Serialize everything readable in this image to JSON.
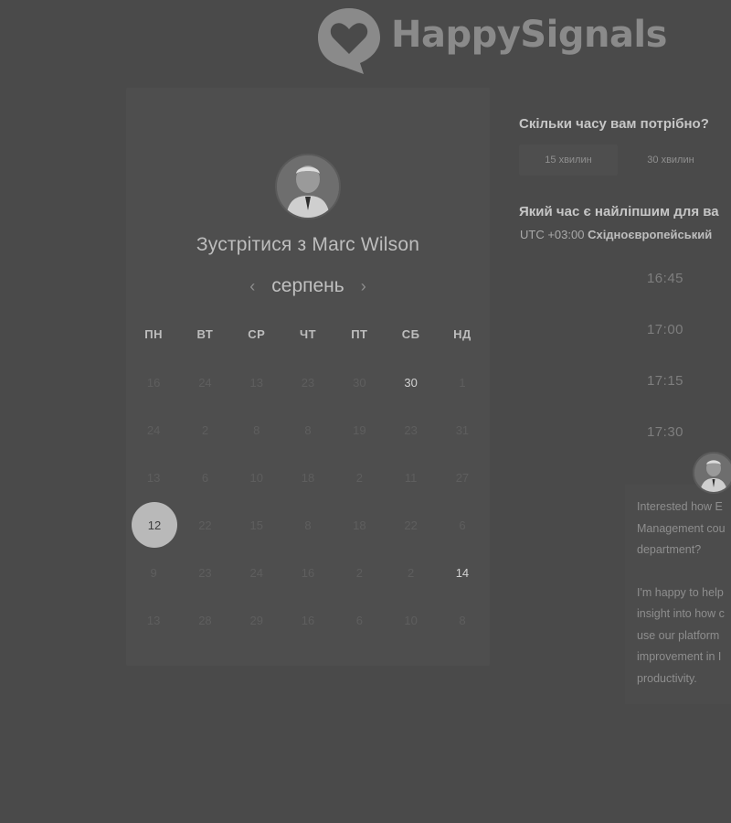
{
  "brand": {
    "name": "HappySignals",
    "logo_icon": "heart-speech-bubble-icon",
    "logo_color": "#8a8a8a"
  },
  "calendar": {
    "host_avatar": "person-avatar",
    "title": "Зустрітися з Marc Wilson",
    "month": "серпень",
    "prev_icon": "chevron-left-icon",
    "next_icon": "chevron-right-icon",
    "weekdays": [
      "ПН",
      "ВТ",
      "СР",
      "ЧТ",
      "ПТ",
      "СБ",
      "НД"
    ],
    "weeks": [
      [
        {
          "d": "16",
          "s": "off"
        },
        {
          "d": "24",
          "s": "off"
        },
        {
          "d": "13",
          "s": "off"
        },
        {
          "d": "23",
          "s": "off"
        },
        {
          "d": "30",
          "s": "off"
        },
        {
          "d": "30",
          "s": "available"
        },
        {
          "d": "1",
          "s": "off"
        }
      ],
      [
        {
          "d": "24",
          "s": "off"
        },
        {
          "d": "2",
          "s": "off"
        },
        {
          "d": "8",
          "s": "off"
        },
        {
          "d": "8",
          "s": "off"
        },
        {
          "d": "19",
          "s": "off"
        },
        {
          "d": "23",
          "s": "off"
        },
        {
          "d": "31",
          "s": "off"
        }
      ],
      [
        {
          "d": "13",
          "s": "off"
        },
        {
          "d": "6",
          "s": "off"
        },
        {
          "d": "10",
          "s": "off"
        },
        {
          "d": "18",
          "s": "off"
        },
        {
          "d": "2",
          "s": "off"
        },
        {
          "d": "11",
          "s": "off"
        },
        {
          "d": "27",
          "s": "off"
        }
      ],
      [
        {
          "d": "12",
          "s": "selected"
        },
        {
          "d": "22",
          "s": "off"
        },
        {
          "d": "15",
          "s": "off"
        },
        {
          "d": "8",
          "s": "off"
        },
        {
          "d": "18",
          "s": "off"
        },
        {
          "d": "22",
          "s": "off"
        },
        {
          "d": "6",
          "s": "off"
        }
      ],
      [
        {
          "d": "9",
          "s": "off"
        },
        {
          "d": "23",
          "s": "off"
        },
        {
          "d": "24",
          "s": "off"
        },
        {
          "d": "16",
          "s": "off"
        },
        {
          "d": "2",
          "s": "off"
        },
        {
          "d": "2",
          "s": "off"
        },
        {
          "d": "14",
          "s": "available"
        }
      ],
      [
        {
          "d": "13",
          "s": "off"
        },
        {
          "d": "28",
          "s": "off"
        },
        {
          "d": "29",
          "s": "off"
        },
        {
          "d": "16",
          "s": "off"
        },
        {
          "d": "6",
          "s": "off"
        },
        {
          "d": "10",
          "s": "off"
        },
        {
          "d": "8",
          "s": "off"
        }
      ]
    ]
  },
  "duration": {
    "question": "Скільки часу вам потрібно?",
    "options": [
      "15 хвилин",
      "30 хвилин"
    ]
  },
  "time": {
    "question": "Який час є найліпшим для ва",
    "tz_offset": "UTC +03:00",
    "tz_name": "Східноєвропейський",
    "slots": [
      "16:45",
      "17:00",
      "17:15",
      "17:30"
    ]
  },
  "chat": {
    "avatar": "person-avatar",
    "lines1": [
      "Interested how E",
      "Management cou",
      "department?"
    ],
    "lines2": [
      "I'm happy to help",
      "insight into how c",
      "use our platform",
      "improvement in I",
      "productivity."
    ]
  }
}
